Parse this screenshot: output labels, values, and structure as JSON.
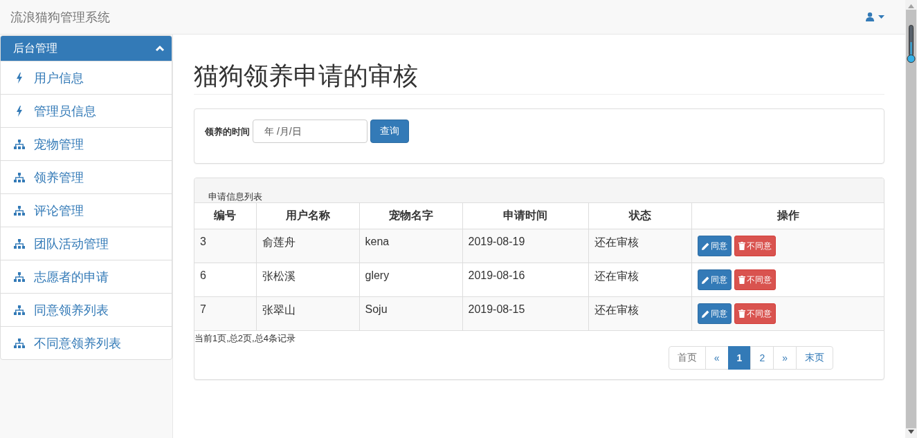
{
  "navbar": {
    "brand": "流浪猫狗管理系统"
  },
  "sidebar": {
    "heading": "后台管理",
    "expanded": true,
    "items": [
      {
        "label": "用户信息",
        "kind": "bolt"
      },
      {
        "label": "管理员信息",
        "kind": "bolt"
      },
      {
        "label": "宠物管理",
        "kind": "sitemap"
      },
      {
        "label": "领养管理",
        "kind": "sitemap"
      },
      {
        "label": "评论管理",
        "kind": "sitemap"
      },
      {
        "label": "团队活动管理",
        "kind": "sitemap"
      },
      {
        "label": "志愿者的申请",
        "kind": "sitemap"
      },
      {
        "label": "同意领养列表",
        "kind": "sitemap"
      },
      {
        "label": "不同意领养列表",
        "kind": "sitemap"
      }
    ]
  },
  "page": {
    "title": "猫狗领养申请的审核"
  },
  "filter": {
    "label": "领养的时间",
    "date_field": {
      "placeholder": "年 /月/日"
    },
    "button": "查询"
  },
  "table": {
    "caption": "申请信息列表",
    "columns": [
      "编号",
      "用户名称",
      "宠物名字",
      "申请时间",
      "状态",
      "操作"
    ],
    "rows": [
      {
        "cells": [
          "3",
          "俞莲舟",
          "kena",
          "2019-08-19",
          "还在审核"
        ],
        "actions": [
          {
            "label": "同意",
            "kind": "approve"
          },
          {
            "label": "不同意",
            "kind": "reject"
          }
        ]
      },
      {
        "cells": [
          "6",
          "张松溪",
          "glery",
          "2019-08-16",
          "还在审核"
        ],
        "actions": [
          {
            "label": "同意",
            "kind": "approve"
          },
          {
            "label": "不同意",
            "kind": "reject"
          }
        ]
      },
      {
        "cells": [
          "7",
          "张翠山",
          "Soju",
          "2019-08-15",
          "还在审核"
        ],
        "actions": [
          {
            "label": "同意",
            "kind": "approve"
          },
          {
            "label": "不同意",
            "kind": "reject"
          }
        ]
      }
    ]
  },
  "summary": "当前1页,总2页,总4条记录",
  "pagination": [
    {
      "label": "首页",
      "selected": false
    },
    {
      "label": "«",
      "selected": false
    },
    {
      "label": "1",
      "selected": true
    },
    {
      "label": "2",
      "selected": false
    },
    {
      "label": "»",
      "selected": false
    },
    {
      "label": "末页",
      "selected": false
    }
  ]
}
